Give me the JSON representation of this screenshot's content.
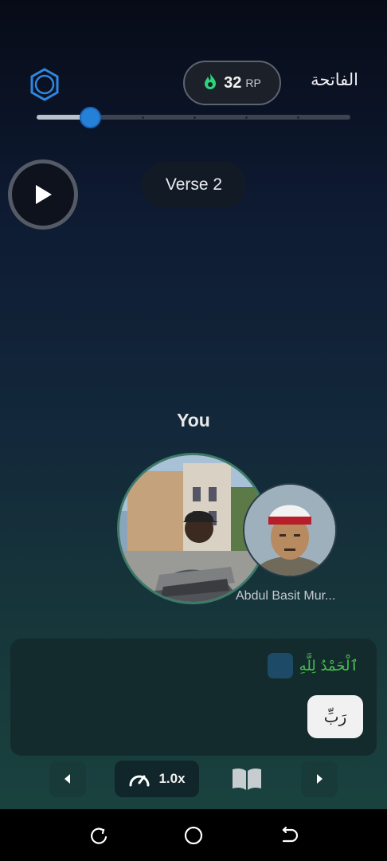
{
  "header": {
    "surah_name": "الفاتحة",
    "rp_value": "32",
    "rp_unit": "RP",
    "progress_fraction": 0.17
  },
  "player": {
    "verse_label": "Verse 2"
  },
  "participants": {
    "you_label": "You",
    "reciter_name": "Abdul Basit Mur..."
  },
  "words": {
    "recited_text": "ٱلْحَمْدُ لِلَّهِ",
    "next_word": "رَبِّ"
  },
  "controls": {
    "speed_label": "1.0x"
  },
  "colors": {
    "accent_blue": "#2580d8",
    "recited_green": "#46c24e",
    "flame_green": "#2dd47a"
  }
}
